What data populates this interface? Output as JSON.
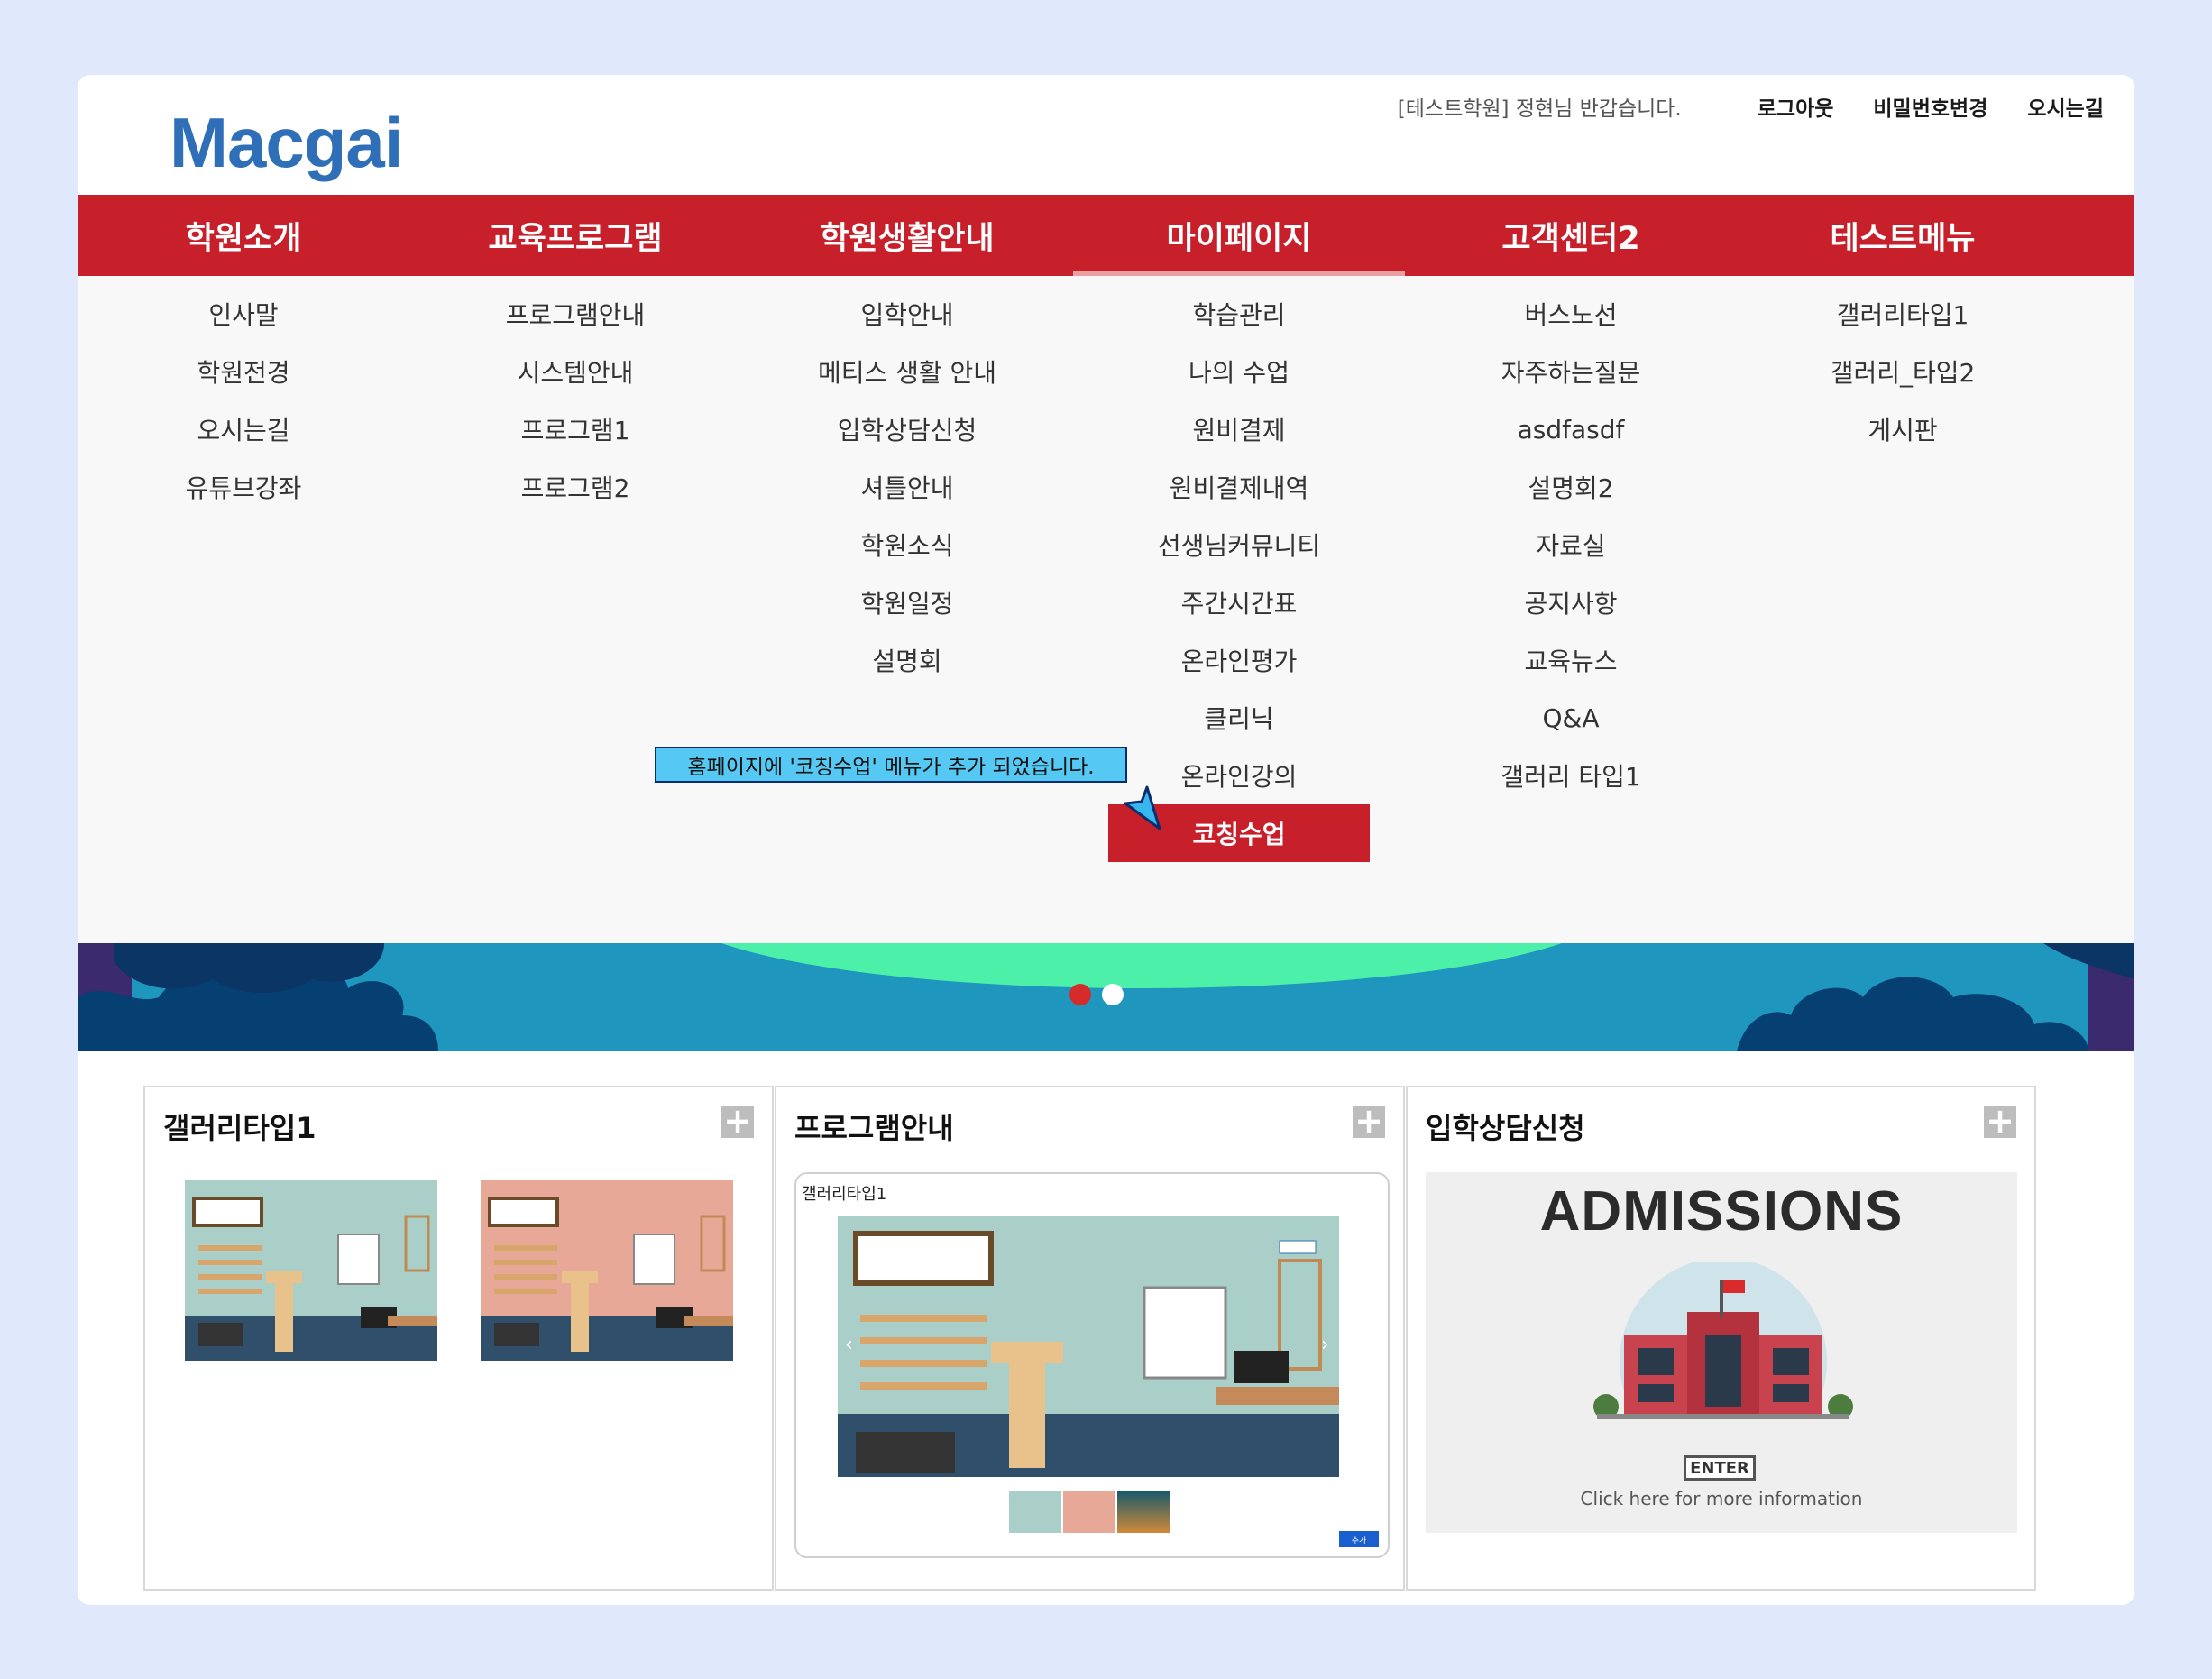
{
  "header": {
    "logo": "Macgai",
    "greeting": "[테스트학원] 정현님 반갑습니다.",
    "links": [
      "로그아웃",
      "비밀번호변경",
      "오시는길"
    ]
  },
  "nav": {
    "items": [
      "학원소개",
      "교육프로그램",
      "학원생활안내",
      "마이페이지",
      "고객센터2",
      "테스트메뉴"
    ],
    "active": "마이페이지"
  },
  "submenu": {
    "col0": [
      "인사말",
      "학원전경",
      "오시는길",
      "유튜브강좌"
    ],
    "col1": [
      "프로그램안내",
      "시스템안내",
      "프로그램1",
      "프로그램2"
    ],
    "col2": [
      "입학안내",
      "메티스 생활 안내",
      "입학상담신청",
      "셔틀안내",
      "학원소식",
      "학원일정",
      "설명회"
    ],
    "col3": [
      "학습관리",
      "나의 수업",
      "원비결제",
      "원비결제내역",
      "선생님커뮤니티",
      "주간시간표",
      "온라인평가",
      "클리닉",
      "온라인강의",
      "코칭수업"
    ],
    "col4": [
      "버스노선",
      "자주하는질문",
      "asdfasdf",
      "설명회2",
      "자료실",
      "공지사항",
      "교육뉴스",
      "Q&A",
      "갤러리 타입1"
    ],
    "col5": [
      "갤러리타입1",
      "갤러리_타입2",
      "게시판"
    ]
  },
  "tooltip": "홈페이지에 '코칭수업' 메뉴가 추가 되었습니다.",
  "panels": {
    "p1": {
      "title": "갤러리타입1"
    },
    "p2": {
      "title": "프로그램안내",
      "inner_label": "갤러리타입1",
      "btn": "수정하기",
      "add": "추가"
    },
    "p3": {
      "title": "입학상담신청",
      "heading": "ADMISSIONS",
      "enter": "ENTER",
      "info": "Click here for more information"
    }
  },
  "colors": {
    "brand_red": "#c8202b",
    "logo_blue": "#2f6fb8",
    "tooltip_bg": "#55c9f3"
  }
}
